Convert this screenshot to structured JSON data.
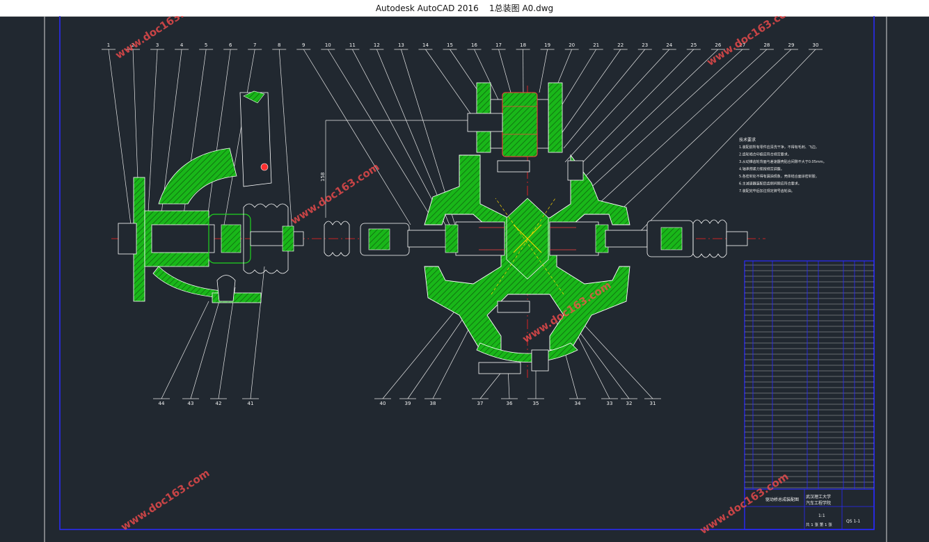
{
  "window": {
    "app_name": "Autodesk AutoCAD 2016",
    "file_name": "1总装图 A0.dwg"
  },
  "colors": {
    "background": "#212830",
    "frame": "#2a2aff",
    "sheet_border": "#d8d8d8",
    "hatch": "#1fd41f",
    "outline": "#ffffff",
    "centerline": "#ff2222",
    "watermark": "#ff4d4d"
  },
  "callouts_top": [
    "1",
    "2",
    "3",
    "4",
    "5",
    "6",
    "7",
    "8",
    "9",
    "10",
    "11",
    "12",
    "13",
    "14",
    "15",
    "16",
    "17",
    "18",
    "19",
    "20",
    "21",
    "22",
    "23",
    "24",
    "25",
    "26",
    "27",
    "28",
    "29",
    "30"
  ],
  "callouts_bottom": [
    "44",
    "43",
    "42",
    "41",
    "40",
    "39",
    "38",
    "37",
    "36",
    "35",
    "34",
    "33",
    "32",
    "31"
  ],
  "dimension_label": "158",
  "watermark_text": "www.doc163.com",
  "tech_notes": {
    "title": "技术要求",
    "lines": [
      "1.装配前所有零件应清洗干净，不得有毛刺、飞边。",
      "2.齿轮啮合印痕应符合规定要求。",
      "3.从动锥齿轮背面与差速器壳贴合间隙不大于0.05mm。",
      "4.轴承预紧力矩按规定调整。",
      "5.各密封处不得有漏油现象，壳体结合面涂密封胶。",
      "6.主减速器装配后齿侧间隙应符合要求。",
      "7.装配完毕后加注规定牌号齿轮油。"
    ]
  },
  "title_block": {
    "school": "武汉理工大学",
    "department": "汽车工程学院",
    "drawing_name": "驱动桥总成装配图",
    "scale": "1:1",
    "sheet": "共 1 张  第 1 张",
    "code": "QS 1-1"
  }
}
